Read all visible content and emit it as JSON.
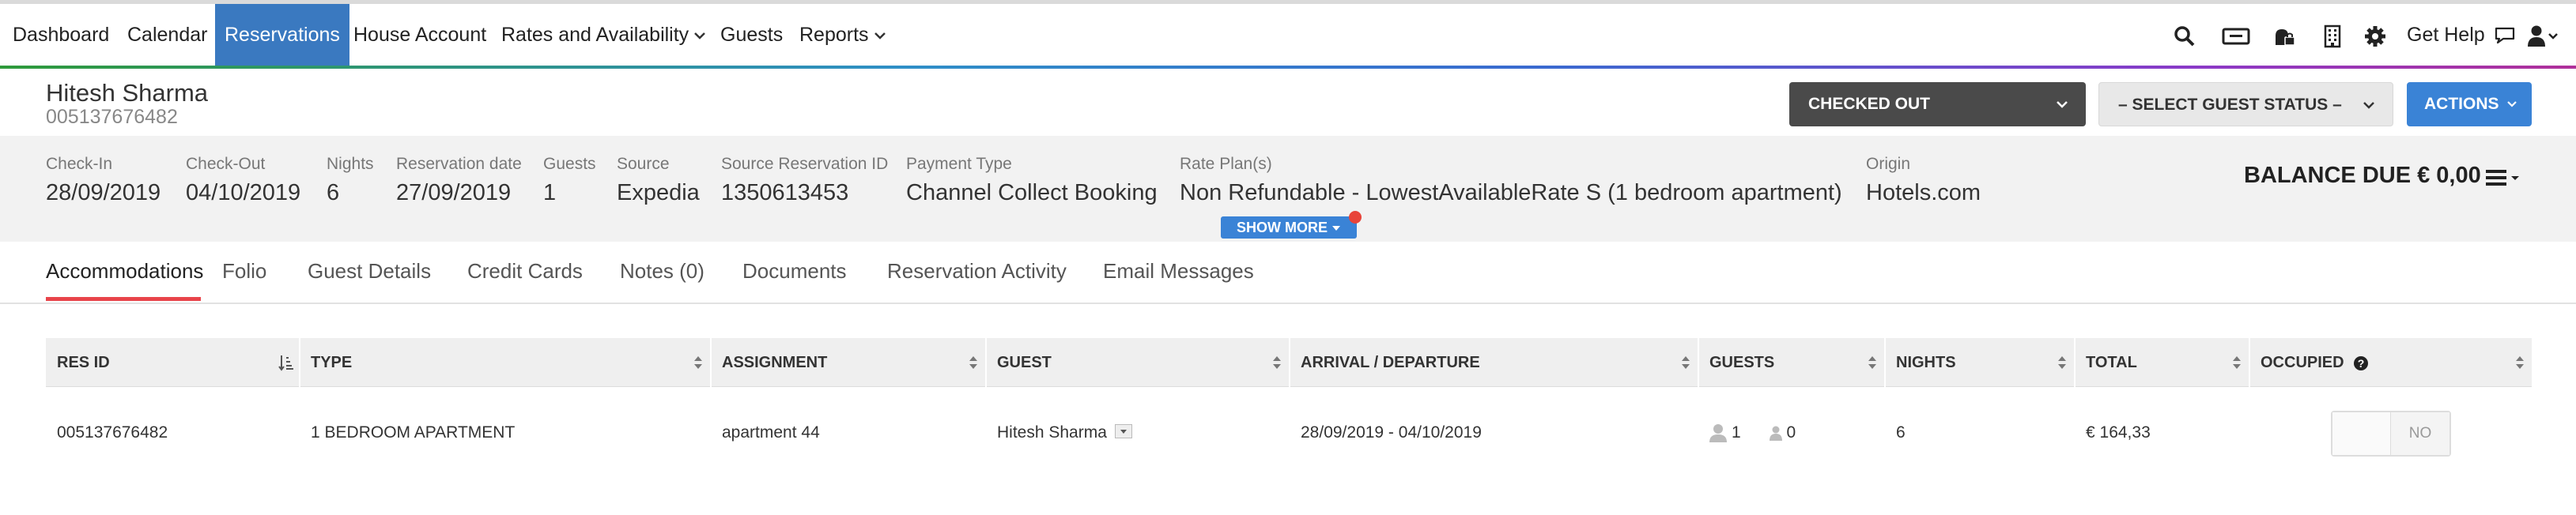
{
  "nav": {
    "items": [
      "Dashboard",
      "Calendar",
      "Reservations",
      "House Account",
      "Rates and Availability",
      "Guests",
      "Reports"
    ],
    "active": "Reservations",
    "help_label": "Get Help",
    "icons": [
      "search-icon",
      "card-icon",
      "bell-lock-icon",
      "building-icon",
      "gear-icon",
      "chat-icon",
      "user-icon"
    ]
  },
  "guest": {
    "name": "Hitesh Sharma",
    "id": "005137676482"
  },
  "buttons": {
    "status": "CHECKED OUT",
    "guest_status": "– SELECT GUEST STATUS –",
    "actions": "ACTIONS"
  },
  "info": {
    "checkin_label": "Check-In",
    "checkin": "28/09/2019",
    "checkout_label": "Check-Out",
    "checkout": "04/10/2019",
    "nights_label": "Nights",
    "nights": "6",
    "resdate_label": "Reservation date",
    "resdate": "27/09/2019",
    "guests_label": "Guests",
    "guests": "1",
    "source_label": "Source",
    "source": "Expedia",
    "sourceid_label": "Source Reservation ID",
    "sourceid": "1350613453",
    "payment_label": "Payment Type",
    "payment": "Channel Collect Booking",
    "rateplan_label": "Rate Plan(s)",
    "rateplan": "Non Refundable - LowestAvailableRate S (1 bedroom apartment)",
    "origin_label": "Origin",
    "origin": "Hotels.com",
    "balance": "BALANCE DUE € 0,00",
    "show_more": "SHOW MORE"
  },
  "tabs": [
    "Accommodations",
    "Folio",
    "Guest Details",
    "Credit Cards",
    "Notes (0)",
    "Documents",
    "Reservation Activity",
    "Email Messages"
  ],
  "active_tab": "Accommodations",
  "table": {
    "headers": [
      "RES ID",
      "TYPE",
      "ASSIGNMENT",
      "GUEST",
      "ARRIVAL / DEPARTURE",
      "GUESTS",
      "NIGHTS",
      "TOTAL",
      "OCCUPIED"
    ],
    "rows": [
      {
        "res_id": "005137676482",
        "type": "1 BEDROOM APARTMENT",
        "assignment": "apartment 44",
        "guest": "Hitesh Sharma",
        "dates": "28/09/2019 - 04/10/2019",
        "adults": "1",
        "children": "0",
        "nights": "6",
        "total": "€ 164,33",
        "occupied": "NO"
      }
    ]
  },
  "colors": {
    "accent": "#3a79c0",
    "actions": "#3a83d6",
    "checked_out": "#4a4a4a",
    "tab_underline": "#e8444a"
  }
}
